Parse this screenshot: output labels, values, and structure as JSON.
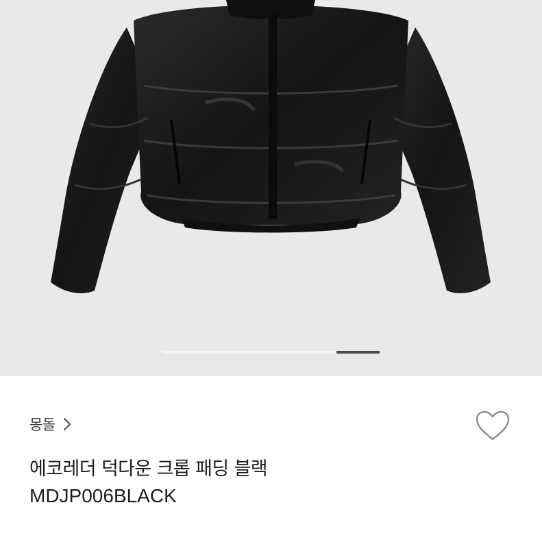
{
  "gallery": {
    "image_alt": "black cropped leather puffer jacket",
    "page_count": 5,
    "current_page": 5,
    "progress": 0.8
  },
  "product": {
    "brand": "몽돌",
    "title": "에코레더 덕다운 크롭 패딩 블랙",
    "code": "MDJP006BLACK"
  },
  "icons": {
    "brand_chevron": "chevron-right-icon",
    "wishlist": "heart-outline-icon"
  },
  "colors": {
    "photo_background": "#e9e9ec",
    "jacket": "#1a1a1b",
    "pager_active": "#4a4a4d",
    "pager_track": "#f4f4f6",
    "text": "#1c1c1e"
  }
}
